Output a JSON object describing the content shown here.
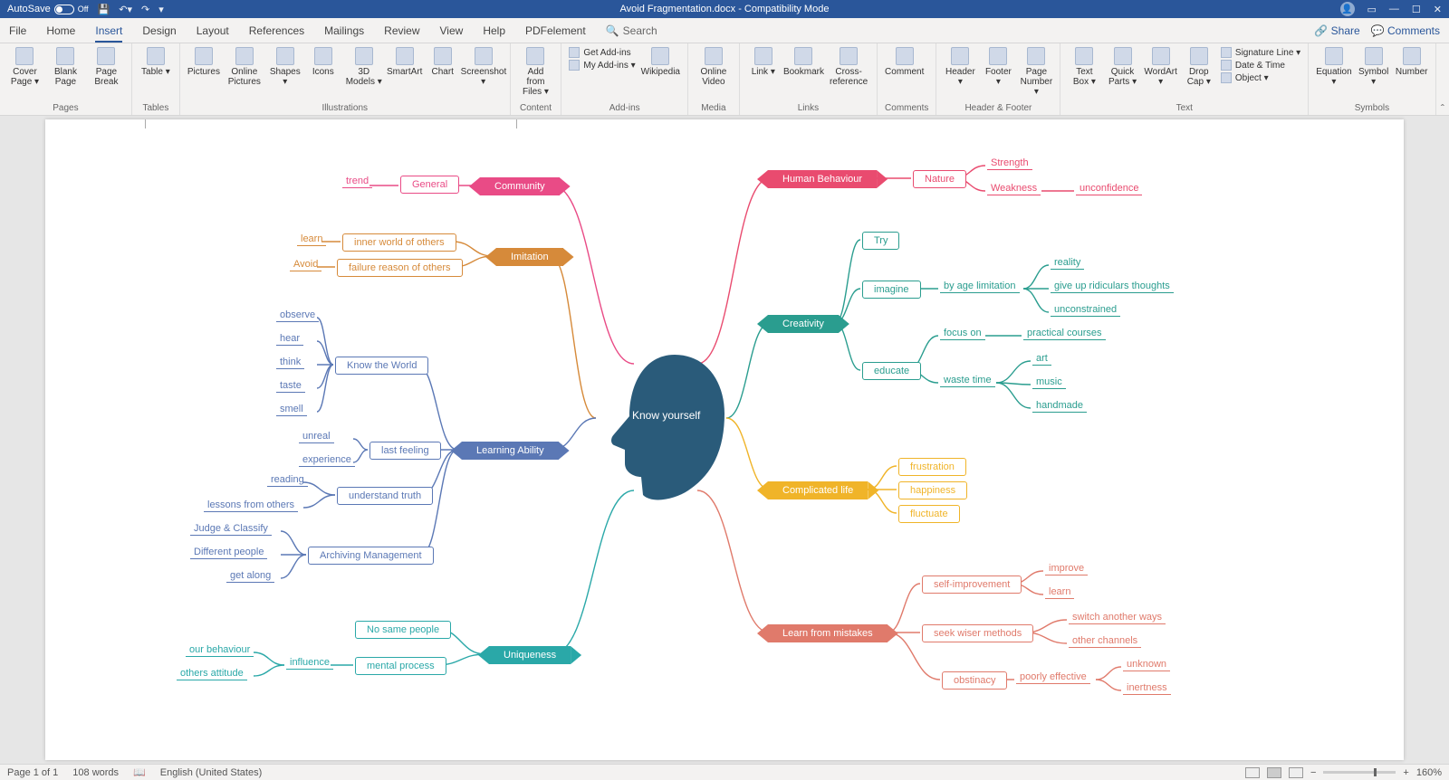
{
  "titlebar": {
    "autosave_label": "AutoSave",
    "autosave_state": "Off",
    "doc_title": "Avoid Fragmentation.docx - Compatibility Mode"
  },
  "menubar": {
    "tabs": [
      "File",
      "Home",
      "Insert",
      "Design",
      "Layout",
      "References",
      "Mailings",
      "Review",
      "View",
      "Help",
      "PDFelement"
    ],
    "active": "Insert",
    "search": "Search",
    "share": "Share",
    "comments": "Comments"
  },
  "ribbon": {
    "groups": [
      {
        "label": "Pages",
        "buttons": [
          {
            "l": "Cover Page ▾"
          },
          {
            "l": "Blank Page"
          },
          {
            "l": "Page Break"
          }
        ]
      },
      {
        "label": "Tables",
        "buttons": [
          {
            "l": "Table ▾"
          }
        ]
      },
      {
        "label": "Illustrations",
        "buttons": [
          {
            "l": "Pictures"
          },
          {
            "l": "Online Pictures"
          },
          {
            "l": "Shapes ▾"
          },
          {
            "l": "Icons"
          },
          {
            "l": "3D Models ▾"
          },
          {
            "l": "SmartArt"
          },
          {
            "l": "Chart"
          },
          {
            "l": "Screenshot ▾"
          }
        ]
      },
      {
        "label": "Content",
        "buttons": [
          {
            "l": "Add from Files ▾"
          }
        ]
      },
      {
        "label": "Add-ins",
        "stack": [
          "Get Add-ins",
          "My Add-ins ▾"
        ],
        "buttons": [
          {
            "l": "Wikipedia"
          }
        ]
      },
      {
        "label": "Media",
        "buttons": [
          {
            "l": "Online Video"
          }
        ]
      },
      {
        "label": "Links",
        "buttons": [
          {
            "l": "Link ▾"
          },
          {
            "l": "Bookmark"
          },
          {
            "l": "Cross-reference"
          }
        ]
      },
      {
        "label": "Comments",
        "buttons": [
          {
            "l": "Comment"
          }
        ]
      },
      {
        "label": "Header & Footer",
        "buttons": [
          {
            "l": "Header ▾"
          },
          {
            "l": "Footer ▾"
          },
          {
            "l": "Page Number ▾"
          }
        ]
      },
      {
        "label": "Text",
        "buttons": [
          {
            "l": "Text Box ▾"
          },
          {
            "l": "Quick Parts ▾"
          },
          {
            "l": "WordArt ▾"
          },
          {
            "l": "Drop Cap ▾"
          }
        ],
        "stack": [
          "Signature Line ▾",
          "Date & Time",
          "Object ▾"
        ]
      },
      {
        "label": "Symbols",
        "buttons": [
          {
            "l": "Equation ▾"
          },
          {
            "l": "Symbol ▾"
          },
          {
            "l": "Number"
          }
        ]
      }
    ]
  },
  "mindmap": {
    "center": "Know yourself",
    "branches": {
      "community": {
        "title": "Community",
        "color": "#e94b86",
        "children": [
          {
            "t": "General",
            "leaves": [
              "trend"
            ]
          }
        ]
      },
      "imitation": {
        "title": "Imitation",
        "color": "#d68a3a",
        "children": [
          {
            "t": "inner world of others",
            "leaves": [
              "learn"
            ]
          },
          {
            "t": "failure reason of others",
            "leaves": [
              "Avoid"
            ]
          }
        ]
      },
      "learning": {
        "title": "Learning Ability",
        "color": "#5b78b5",
        "children": [
          {
            "t": "Know the World",
            "leaves": [
              "observe",
              "hear",
              "think",
              "taste",
              "smell"
            ]
          },
          {
            "t": "last feeling",
            "leaves": [
              "unreal",
              "experience"
            ]
          },
          {
            "t": "understand truth",
            "leaves": [
              "reading",
              "lessons from others"
            ]
          },
          {
            "t": "Archiving Management",
            "leaves": [
              "Judge & Classify",
              "Different people",
              "get along"
            ]
          }
        ]
      },
      "uniqueness": {
        "title": "Uniqueness",
        "color": "#2aa8a8",
        "children": [
          {
            "t": "No same people"
          },
          {
            "t": "mental process",
            "via": "influence",
            "leaves": [
              "our behaviour",
              "others attitude"
            ]
          }
        ]
      },
      "human": {
        "title": "Human Behaviour",
        "color": "#e94b6f",
        "children": [
          {
            "t": "Nature",
            "leaves": [
              "Strength",
              "Weakness"
            ],
            "leaf2": {
              "Weakness": "unconfidence"
            }
          }
        ]
      },
      "creativity": {
        "title": "Creativity",
        "color": "#2a9d8f",
        "children": [
          {
            "t": "Try"
          },
          {
            "t": "imagine",
            "via": "by age limitation",
            "leaves": [
              "reality",
              "give up ridiculars thoughts",
              "unconstrained"
            ]
          },
          {
            "t": "educate",
            "sub": [
              {
                "via": "focus on",
                "leaves": [
                  "practical courses"
                ]
              },
              {
                "via": "waste time",
                "leaves": [
                  "art",
                  "music",
                  "handmade"
                ]
              }
            ]
          }
        ]
      },
      "complicated": {
        "title": "Complicated life",
        "color": "#f0b429",
        "children": [
          {
            "t": "frustration"
          },
          {
            "t": "happiness"
          },
          {
            "t": "fluctuate"
          }
        ]
      },
      "mistakes": {
        "title": "Learn from mistakes",
        "color": "#e07a6b",
        "children": [
          {
            "t": "self-improvement",
            "leaves": [
              "improve",
              "learn"
            ]
          },
          {
            "t": "seek wiser methods",
            "leaves": [
              "switch another ways",
              "other channels"
            ]
          },
          {
            "t": "obstinacy",
            "via": "poorly effective",
            "leaves": [
              "unknown",
              "inertness"
            ]
          }
        ]
      }
    }
  },
  "statusbar": {
    "page": "Page 1 of 1",
    "words": "108 words",
    "lang": "English (United States)",
    "zoom": "160%"
  }
}
